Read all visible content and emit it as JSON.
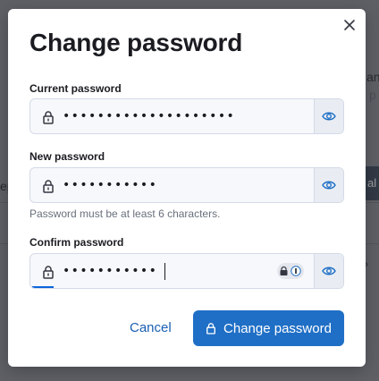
{
  "background": {
    "fragment_an": "an",
    "fragment_p": "p",
    "fragment_ep": "ep",
    "fragment_button": "al",
    "fragment_caret": "›"
  },
  "dialog": {
    "title": "Change password",
    "close_icon": "close-icon",
    "fields": [
      {
        "label": "Current password",
        "value": "••••••••••••••••••••",
        "icon": "lock-icon",
        "append_icon": "eye-icon"
      },
      {
        "label": "New password",
        "value": "•••••••••••",
        "icon": "lock-icon",
        "append_icon": "eye-icon",
        "help": "Password must be at least 6 characters."
      },
      {
        "label": "Confirm password",
        "value": "•••••••••••",
        "icon": "lock-icon",
        "append_icon": "eye-icon",
        "extension_icon": "password-manager-icon"
      }
    ],
    "cancel_label": "Cancel",
    "submit_label": "Change password",
    "submit_icon": "lock-icon"
  },
  "colors": {
    "primary": "#1f6fc6",
    "link": "#1a5fb4",
    "field_bg": "#f7f8fc",
    "focus": "#0b64dd"
  }
}
